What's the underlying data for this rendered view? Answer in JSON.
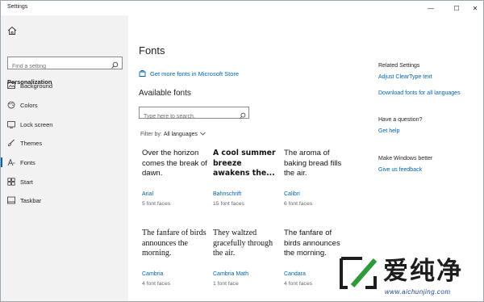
{
  "window": {
    "title": "Settings",
    "controls": {
      "minimize": "—",
      "maximize": "☐",
      "close": "✕"
    }
  },
  "sidebar": {
    "search_placeholder": "Find a setting",
    "section_label": "Personalization",
    "items": [
      {
        "label": "Background",
        "icon": "picture-icon",
        "selected": false
      },
      {
        "label": "Colors",
        "icon": "palette-icon",
        "selected": false
      },
      {
        "label": "Lock screen",
        "icon": "lock-screen-icon",
        "selected": false
      },
      {
        "label": "Themes",
        "icon": "brush-icon",
        "selected": false
      },
      {
        "label": "Fonts",
        "icon": "font-icon",
        "selected": true
      },
      {
        "label": "Start",
        "icon": "start-icon",
        "selected": false
      },
      {
        "label": "Taskbar",
        "icon": "taskbar-icon",
        "selected": false
      }
    ]
  },
  "main": {
    "title": "Fonts",
    "store_link": "Get more fonts in Microsoft Store",
    "available_heading": "Available fonts",
    "font_search_placeholder": "Type here to search.",
    "filter_label": "Filter by:",
    "filter_value": "All languages",
    "fonts": [
      {
        "sample": "Over the horizon comes the break of dawn.",
        "name": "Arial",
        "faces": "5 font faces"
      },
      {
        "sample": "A cool summer breeze awakens the...",
        "name": "Bahnschrift",
        "faces": "15 font faces"
      },
      {
        "sample": "The aroma of baking bread fills the air.",
        "name": "Calibri",
        "faces": "6 font faces"
      },
      {
        "sample": "The fanfare of birds announces the morning.",
        "name": "Cambria",
        "faces": "4 font faces"
      },
      {
        "sample": "They waltzed gracefully through the air.",
        "name": "Cambria Math",
        "faces": "1 font face"
      },
      {
        "sample": "The fanfare of birds announces the morning.",
        "name": "Candara",
        "faces": "4 font faces"
      }
    ]
  },
  "related": {
    "heading": "Related Settings",
    "links": [
      "Adjust ClearType text",
      "Download fonts for all languages"
    ],
    "question_heading": "Have a question?",
    "help_link": "Get help",
    "better_heading": "Make Windows better",
    "feedback_link": "Give us feedback"
  },
  "watermark": {
    "text_cn": "爱纯净",
    "url": "www.aichunjing.com"
  },
  "colors": {
    "accent": "#0063b1",
    "sidebar_bg": "#f2f2f2",
    "watermark_green": "#2e9a3a"
  }
}
